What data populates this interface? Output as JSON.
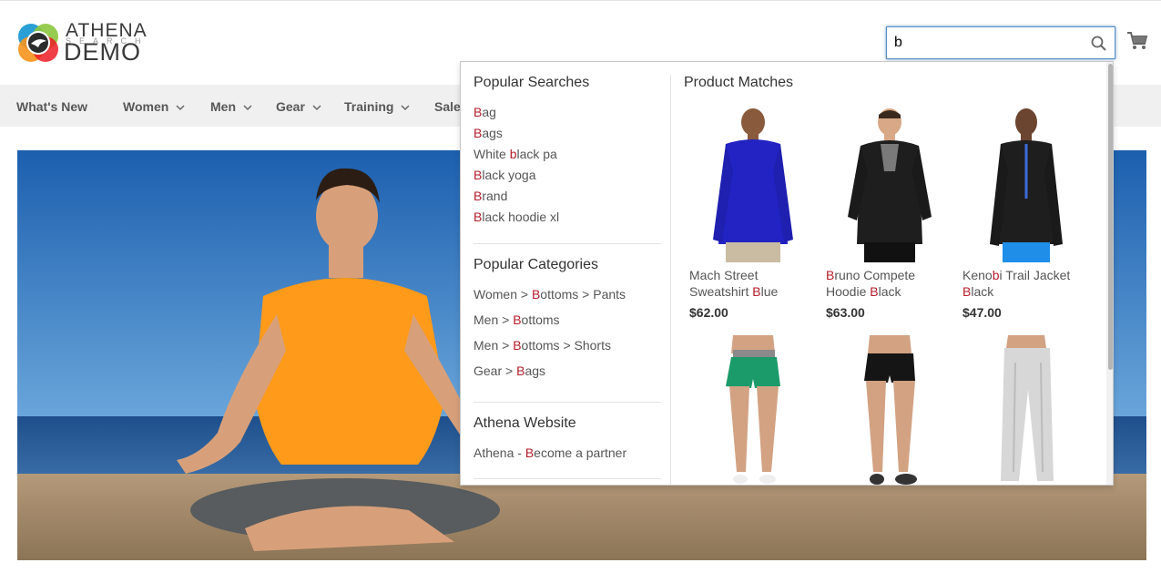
{
  "logo": {
    "line1": "ATHENA",
    "line2": "SEARCH",
    "line3": "DEMO"
  },
  "search": {
    "value": "b",
    "placeholder": ""
  },
  "nav": {
    "items": [
      {
        "label": "What's New"
      },
      {
        "label": "Women"
      },
      {
        "label": "Men"
      },
      {
        "label": "Gear"
      },
      {
        "label": "Training"
      },
      {
        "label": "Sale"
      }
    ]
  },
  "dropdown": {
    "popular_searches": {
      "title": "Popular Searches",
      "items": [
        {
          "hl": "B",
          "rest": "ag"
        },
        {
          "hl": "B",
          "rest": "ags"
        },
        {
          "pre": "White ",
          "hl": "b",
          "rest": "lack pa"
        },
        {
          "hl": "B",
          "rest": "lack yoga"
        },
        {
          "hl": "B",
          "rest": "rand"
        },
        {
          "hl": "B",
          "rest": "lack hoodie xl"
        }
      ]
    },
    "popular_categories": {
      "title": "Popular Categories",
      "items": [
        {
          "pre": "Women > ",
          "hl": "B",
          "rest": "ottoms > Pants"
        },
        {
          "pre": "Men > ",
          "hl": "B",
          "rest": "ottoms"
        },
        {
          "pre": "Men > ",
          "hl": "B",
          "rest": "ottoms > Shorts"
        },
        {
          "pre": "Gear > ",
          "hl": "B",
          "rest": "ags"
        }
      ]
    },
    "athena_website": {
      "title": "Athena Website",
      "items": [
        {
          "pre": "Athena - ",
          "hl": "B",
          "rest": "ecome a partner"
        }
      ]
    },
    "product_matches": {
      "title": "Product Matches",
      "products": [
        {
          "name_pre": "Mach Street Sweatshirt ",
          "name_hl": "B",
          "name_rest": "lue",
          "price": "$62.00"
        },
        {
          "name_pre": "",
          "name_hl": "B",
          "name_rest": "runo Compete Hoodie ",
          "name_hl2": "B",
          "name_rest2": "lack",
          "price": "$63.00"
        },
        {
          "name_pre": "Keno",
          "name_hl": "b",
          "name_rest": "i Trail Jacket ",
          "name_hl2": "B",
          "name_rest2": "lack",
          "price": "$47.00"
        }
      ]
    }
  },
  "colors": {
    "highlight": "#b41c2b",
    "focus_border": "#5a8fc4",
    "nav_bg": "#f0f0f0"
  }
}
